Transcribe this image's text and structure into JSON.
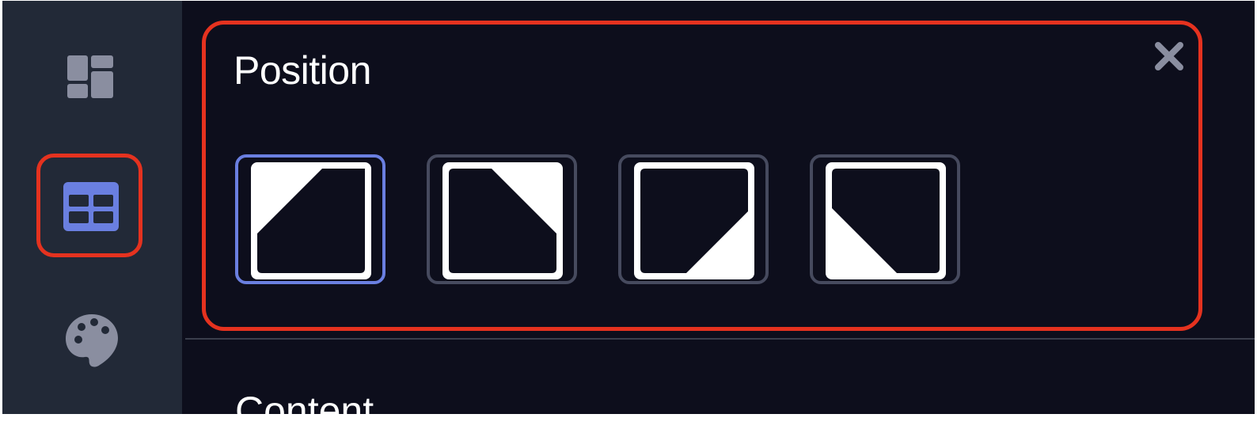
{
  "sidebar": {
    "items": [
      {
        "icon": "dashboard-icon"
      },
      {
        "icon": "table-layout-icon",
        "active": true
      },
      {
        "icon": "palette-icon"
      }
    ]
  },
  "position_section": {
    "title": "Position",
    "close_icon": "close-icon",
    "options": [
      {
        "id": "top-left",
        "selected": true
      },
      {
        "id": "top-right",
        "selected": false
      },
      {
        "id": "bottom-right",
        "selected": false
      },
      {
        "id": "bottom-left",
        "selected": false
      }
    ]
  },
  "content_section": {
    "title": "Content"
  },
  "colors": {
    "background": "#0d0e1c",
    "sidebar": "#222937",
    "accent": "#6a7fe0",
    "highlight": "#e5321f",
    "muted_icon": "#8a8ea0"
  }
}
